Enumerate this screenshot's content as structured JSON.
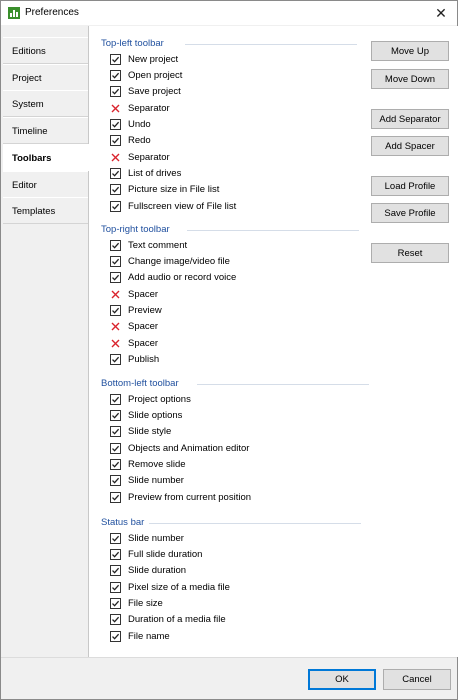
{
  "window": {
    "title": "Preferences"
  },
  "sidebar": {
    "items": [
      {
        "label": "Editions",
        "active": false
      },
      {
        "label": "Project",
        "active": false
      },
      {
        "label": "System",
        "active": false
      },
      {
        "label": "Timeline",
        "active": false
      },
      {
        "label": "Toolbars",
        "active": true
      },
      {
        "label": "Editor",
        "active": false
      },
      {
        "label": "Templates",
        "active": false
      }
    ]
  },
  "groups": [
    {
      "title": "Top-left toolbar",
      "items": [
        {
          "label": "New project",
          "state": "checked"
        },
        {
          "label": "Open project",
          "state": "checked"
        },
        {
          "label": "Save project",
          "state": "checked"
        },
        {
          "label": "Separator",
          "state": "removable"
        },
        {
          "label": "Undo",
          "state": "checked"
        },
        {
          "label": "Redo",
          "state": "checked"
        },
        {
          "label": "Separator",
          "state": "removable"
        },
        {
          "label": "List of drives",
          "state": "checked"
        },
        {
          "label": "Picture size in File list",
          "state": "checked"
        },
        {
          "label": "Fullscreen view of File list",
          "state": "checked"
        }
      ]
    },
    {
      "title": "Top-right toolbar",
      "items": [
        {
          "label": "Text comment",
          "state": "checked"
        },
        {
          "label": "Change image/video file",
          "state": "checked"
        },
        {
          "label": "Add audio or record voice",
          "state": "checked"
        },
        {
          "label": "Spacer",
          "state": "removable"
        },
        {
          "label": "Preview",
          "state": "checked"
        },
        {
          "label": "Spacer",
          "state": "removable"
        },
        {
          "label": "Spacer",
          "state": "removable"
        },
        {
          "label": "Publish",
          "state": "checked"
        }
      ]
    },
    {
      "title": "Bottom-left toolbar",
      "items": [
        {
          "label": "Project options",
          "state": "checked"
        },
        {
          "label": "Slide options",
          "state": "checked"
        },
        {
          "label": "Slide style",
          "state": "checked"
        },
        {
          "label": "Objects and Animation editor",
          "state": "checked"
        },
        {
          "label": "Remove slide",
          "state": "checked"
        },
        {
          "label": "Slide number",
          "state": "checked"
        },
        {
          "label": "Preview from current position",
          "state": "checked"
        }
      ]
    },
    {
      "title": "Status bar",
      "items": [
        {
          "label": "Slide number",
          "state": "checked"
        },
        {
          "label": "Full slide duration",
          "state": "checked"
        },
        {
          "label": "Slide duration",
          "state": "checked"
        },
        {
          "label": "Pixel size of a media file",
          "state": "checked"
        },
        {
          "label": "File size",
          "state": "checked"
        },
        {
          "label": "Duration of a media file",
          "state": "checked"
        },
        {
          "label": "File name",
          "state": "checked"
        }
      ]
    }
  ],
  "actions": {
    "move_up": "Move Up",
    "move_down": "Move Down",
    "add_separator": "Add Separator",
    "add_spacer": "Add Spacer",
    "load_profile": "Load Profile",
    "save_profile": "Save Profile",
    "reset": "Reset"
  },
  "footer": {
    "ok": "OK",
    "cancel": "Cancel"
  },
  "colors": {
    "group_title": "#1f4f9e",
    "remove_mark": "#d9232d",
    "accent": "#0078d7"
  }
}
